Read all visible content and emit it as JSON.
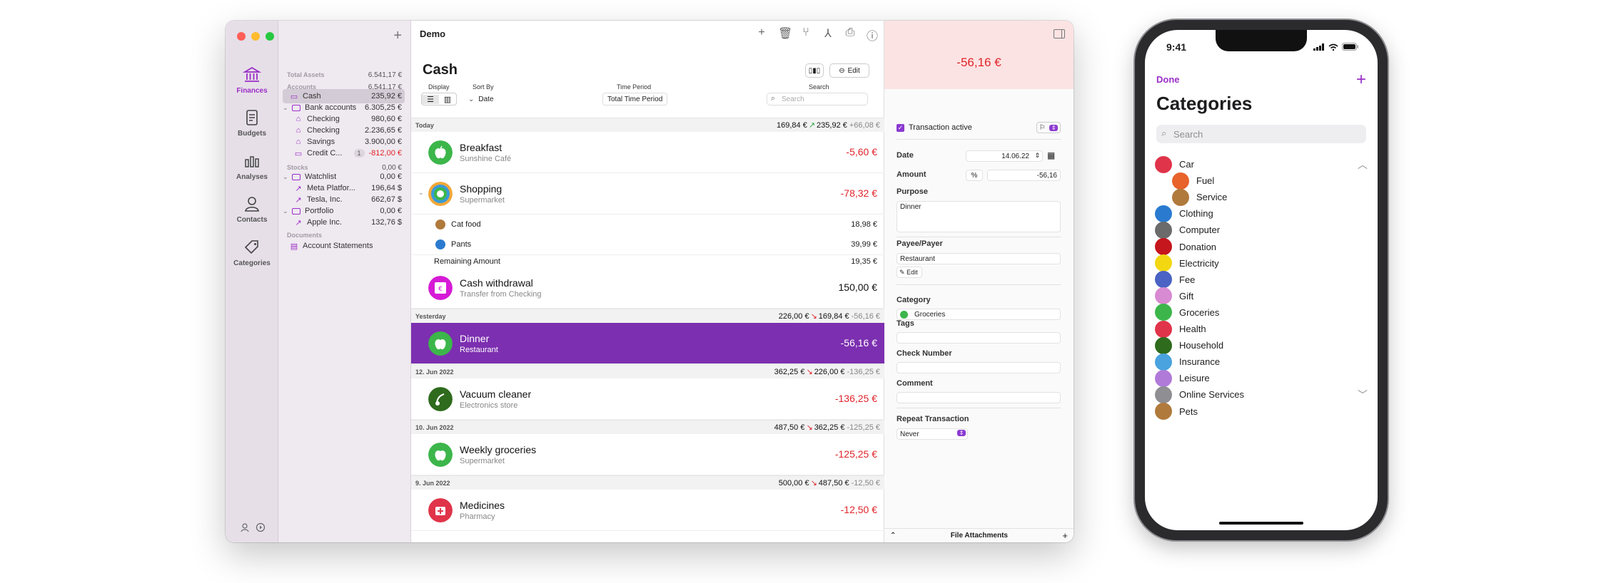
{
  "window": {
    "title": "Demo"
  },
  "rail": {
    "items": [
      {
        "label": "Finances",
        "icon": "bank-icon",
        "active": true
      },
      {
        "label": "Budgets",
        "icon": "notes-icon"
      },
      {
        "label": "Analyses",
        "icon": "bar-chart-icon"
      },
      {
        "label": "Contacts",
        "icon": "person-icon"
      },
      {
        "label": "Categories",
        "icon": "tag-icon"
      }
    ]
  },
  "sidebar": {
    "total_assets_label": "Total Assets",
    "total_assets_value": "6.541,17 €",
    "accounts_label": "Accounts",
    "accounts_value": "6.541,17 €",
    "cash": {
      "name": "Cash",
      "value": "235,92 €"
    },
    "bank_accounts": {
      "name": "Bank accounts",
      "value": "6.305,25 €"
    },
    "bank_items": [
      {
        "name": "Checking",
        "value": "980,60 €"
      },
      {
        "name": "Checking",
        "value": "2.236,65 €"
      },
      {
        "name": "Savings",
        "value": "3.900,00 €"
      }
    ],
    "credit": {
      "name": "Credit C...",
      "badge": "1",
      "value": "-812,00 €"
    },
    "stocks_label": "Stocks",
    "stocks_value": "0,00 €",
    "watchlist": {
      "name": "Watchlist",
      "value": "0,00 €"
    },
    "watch_items": [
      {
        "name": "Meta Platfor...",
        "value": "196,64 $"
      },
      {
        "name": "Tesla, Inc.",
        "value": "662,67 $"
      }
    ],
    "portfolio": {
      "name": "Portfolio",
      "value": "0,00 €"
    },
    "portfolio_items": [
      {
        "name": "Apple Inc.",
        "value": "132,76 $"
      }
    ],
    "documents_label": "Documents",
    "statements": "Account Statements"
  },
  "main": {
    "account_title": "Cash",
    "edit_label": "Edit",
    "display_label": "Display",
    "sort_label": "Sort By",
    "sort_value": "Date",
    "period_label": "Time Period",
    "period_value": "Total Time Period",
    "search_label": "Search",
    "search_placeholder": "Search",
    "days": [
      {
        "date": "Today",
        "from": "169,84 €",
        "to": "235,92 €",
        "diff": "+66,08 €",
        "dir": "up"
      },
      {
        "date": "Yesterday",
        "from": "226,00 €",
        "to": "169,84 €",
        "diff": "-56,16 €",
        "dir": "down"
      },
      {
        "date": "12. Jun 2022",
        "from": "362,25 €",
        "to": "226,00 €",
        "diff": "-136,25 €",
        "dir": "down"
      },
      {
        "date": "10. Jun 2022",
        "from": "487,50 €",
        "to": "362,25 €",
        "diff": "-125,25 €",
        "dir": "down"
      },
      {
        "date": "9. Jun 2022",
        "from": "500,00 €",
        "to": "487,50 €",
        "diff": "-12,50 €",
        "dir": "down"
      }
    ],
    "transactions": [
      {
        "title": "Breakfast",
        "sub": "Sunshine Café",
        "amount": "-5,60 €",
        "color": "#3cb64a"
      },
      {
        "title": "Shopping",
        "sub": "Supermarket",
        "amount": "-78,32 €",
        "color": "#3a9ad9"
      },
      {
        "title": "Cash withdrawal",
        "sub": "Transfer from Checking",
        "amount": "150,00 €",
        "color": "#d61bd6"
      },
      {
        "title": "Dinner",
        "sub": "Restaurant",
        "amount": "-56,16 €",
        "color": "#3cb64a"
      },
      {
        "title": "Vacuum cleaner",
        "sub": "Electronics store",
        "amount": "-136,25 €",
        "color": "#2e6b1d"
      },
      {
        "title": "Weekly groceries",
        "sub": "Supermarket",
        "amount": "-125,25 €",
        "color": "#3cb64a"
      },
      {
        "title": "Medicines",
        "sub": "Pharmacy",
        "amount": "-12,50 €",
        "color": "#e0344a"
      }
    ],
    "splits": [
      {
        "name": "Cat food",
        "amount": "18,98 €",
        "color": "#b07a3c"
      },
      {
        "name": "Pants",
        "amount": "39,99 €",
        "color": "#2a7bd0"
      }
    ],
    "remaining_label": "Remaining Amount",
    "remaining_value": "19,35 €"
  },
  "detail": {
    "amount": "-56,16 €",
    "active_label": "Transaction active",
    "date_label": "Date",
    "date_value": "14.06.22",
    "amount_label": "Amount",
    "amount_value": "-56,16",
    "percent": "%",
    "purpose_label": "Purpose",
    "purpose_value": "Dinner",
    "payee_label": "Payee/Payer",
    "payee_value": "Restaurant",
    "payee_edit": "Edit",
    "category_label": "Category",
    "category_value": "Groceries",
    "tags_label": "Tags",
    "check_label": "Check Number",
    "comment_label": "Comment",
    "repeat_label": "Repeat Transaction",
    "repeat_value": "Never",
    "attachments_label": "File Attachments"
  },
  "phone": {
    "time": "9:41",
    "done": "Done",
    "title": "Categories",
    "search_placeholder": "Search",
    "categories": [
      {
        "name": "Car",
        "color": "#e0344a",
        "chev": "up"
      },
      {
        "name": "Fuel",
        "color": "#e8622c",
        "sub": true
      },
      {
        "name": "Service",
        "color": "#b07a3c",
        "sub": true
      },
      {
        "name": "Clothing",
        "color": "#2a7bd0"
      },
      {
        "name": "Computer",
        "color": "#6b6b6b"
      },
      {
        "name": "Donation",
        "color": "#c5161d"
      },
      {
        "name": "Electricity",
        "color": "#f2d711"
      },
      {
        "name": "Fee",
        "color": "#4a63c4"
      },
      {
        "name": "Gift",
        "color": "#d88ad2"
      },
      {
        "name": "Groceries",
        "color": "#3cb64a"
      },
      {
        "name": "Health",
        "color": "#e0344a"
      },
      {
        "name": "Household",
        "color": "#2e6b1d"
      },
      {
        "name": "Insurance",
        "color": "#4aa3df"
      },
      {
        "name": "Leisure",
        "color": "#b07ad9"
      },
      {
        "name": "Online Services",
        "color": "#8e8e93",
        "chev": "down"
      },
      {
        "name": "Pets",
        "color": "#b07a3c"
      }
    ]
  }
}
